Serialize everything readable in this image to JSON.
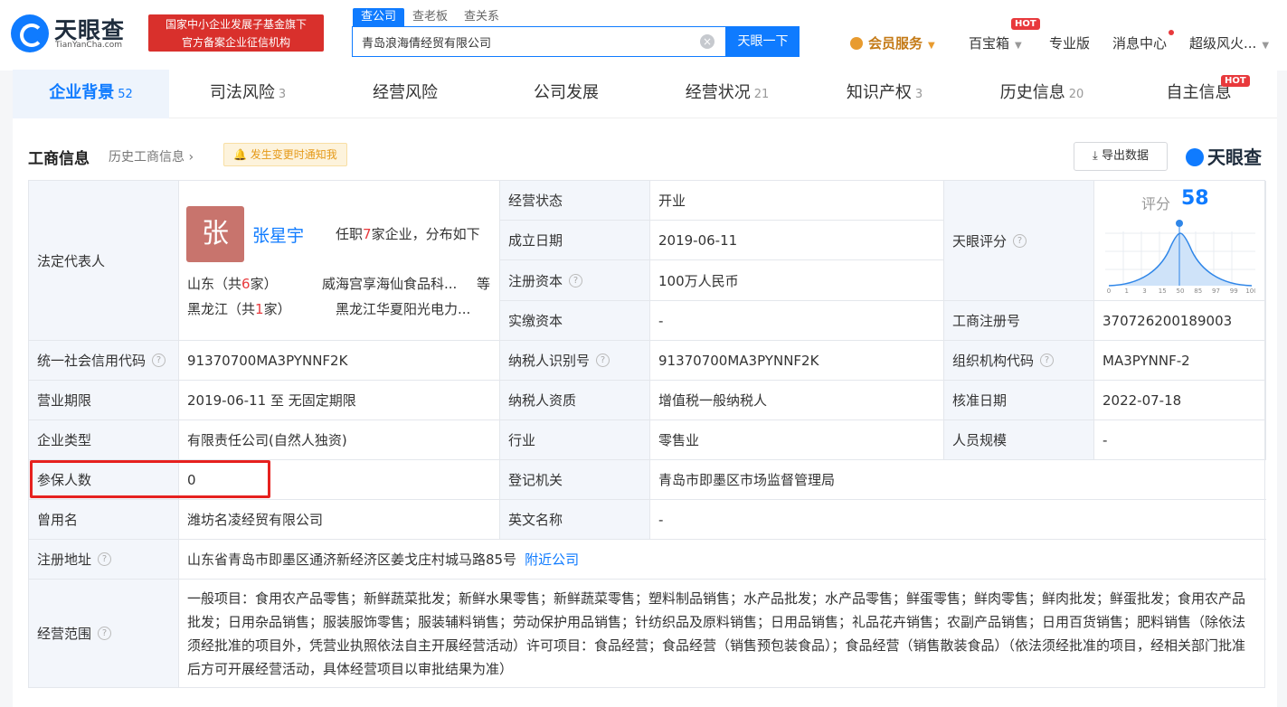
{
  "brand": {
    "name_cn": "天眼查",
    "name_en": "TianYanCha.com",
    "slogan_line1": "国家中小企业发展子基金旗下",
    "slogan_line2": "官方备案企业征信机构"
  },
  "search": {
    "tabs": [
      "查公司",
      "查老板",
      "查关系"
    ],
    "query": "青岛浪海倩经贸有限公司",
    "button": "天眼一下"
  },
  "nav": {
    "vip": "会员服务",
    "treasure": "百宝箱",
    "hot": "HOT",
    "pro": "专业版",
    "messages": "消息中心",
    "user": "超级风火..."
  },
  "tabs": [
    {
      "label": "企业背景",
      "count": "52"
    },
    {
      "label": "司法风险",
      "count": "3"
    },
    {
      "label": "经营风险",
      "count": ""
    },
    {
      "label": "公司发展",
      "count": ""
    },
    {
      "label": "经营状况",
      "count": "21"
    },
    {
      "label": "知识产权",
      "count": "3"
    },
    {
      "label": "历史信息",
      "count": "20"
    },
    {
      "label": "自主信息",
      "count": ""
    }
  ],
  "section": {
    "title": "工商信息",
    "history_link": "历史工商信息",
    "notify": "发生变更时通知我",
    "export": "导出数据",
    "brand": "天眼查"
  },
  "legal": {
    "label": "法定代表人",
    "avatar_char": "张",
    "name": "张星宇",
    "desc_pre": "任职",
    "desc_num": "7",
    "desc_post": "家企业，分布如下",
    "regions": [
      {
        "pre": "山东（共",
        "num": "6",
        "post": "家）",
        "company": "威海宫享海仙食品科...",
        "suffix": "等"
      },
      {
        "pre": "黑龙江（共",
        "num": "1",
        "post": "家）",
        "company": "黑龙江华夏阳光电力...",
        "suffix": ""
      }
    ]
  },
  "score": {
    "label": "天眼评分",
    "title": "评分",
    "value": "58",
    "ticks": [
      "0",
      "1",
      "3",
      "15",
      "50",
      "85",
      "97",
      "99",
      "100"
    ]
  },
  "fields": {
    "status_label": "经营状态",
    "status": "开业",
    "found_label": "成立日期",
    "found": "2019-06-11",
    "capital_label": "注册资本",
    "capital": "100万人民币",
    "paid_label": "实缴资本",
    "paid": "-",
    "regno_label": "工商注册号",
    "regno": "370726200189003",
    "credit_label": "统一社会信用代码",
    "credit": "91370700MA3PYNNF2K",
    "taxid_label": "纳税人识别号",
    "taxid": "91370700MA3PYNNF2K",
    "org_label": "组织机构代码",
    "org": "MA3PYNNF-2",
    "term_label": "营业期限",
    "term": "2019-06-11 至 无固定期限",
    "taxq_label": "纳税人资质",
    "taxq": "增值税一般纳税人",
    "approve_label": "核准日期",
    "approve": "2022-07-18",
    "type_label": "企业类型",
    "type": "有限责任公司(自然人独资)",
    "industry_label": "行业",
    "industry": "零售业",
    "staff_label": "人员规模",
    "staff": "-",
    "insured_label": "参保人数",
    "insured": "0",
    "authority_label": "登记机关",
    "authority": "青岛市即墨区市场监督管理局",
    "former_label": "曾用名",
    "former": "潍坊名凌经贸有限公司",
    "en_label": "英文名称",
    "en": "-",
    "addr_label": "注册地址",
    "addr": "山东省青岛市即墨区通济新经济区姜戈庄村城马路85号",
    "nearby": "附近公司",
    "scope_label": "经营范围",
    "scope": "一般项目：食用农产品零售；新鲜蔬菜批发；新鲜水果零售；新鲜蔬菜零售；塑料制品销售；水产品批发；水产品零售；鲜蛋零售；鲜肉零售；鲜肉批发；鲜蛋批发；食用农产品批发；日用杂品销售；服装服饰零售；服装辅料销售；劳动保护用品销售；针纺织品及原料销售；日用品销售；礼品花卉销售；农副产品销售；日用百货销售；肥料销售（除依法须经批准的项目外，凭营业执照依法自主开展经营活动）许可项目：食品经营；食品经营（销售预包装食品）；食品经营（销售散装食品）（依法须经批准的项目，经相关部门批准后方可开展经营活动，具体经营项目以审批结果为准）"
  }
}
